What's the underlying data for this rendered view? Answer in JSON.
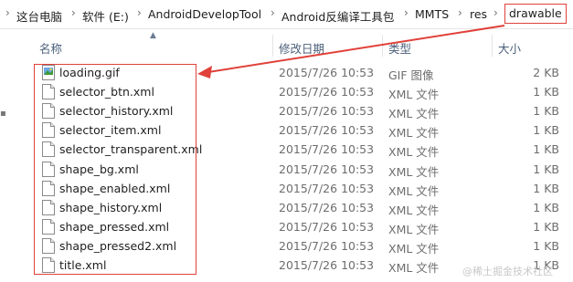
{
  "breadcrumb": {
    "items": [
      "这台电脑",
      "软件 (E:)",
      "AndroidDevelopTool",
      "Android反编译工具包",
      "MMTS",
      "res",
      "drawable"
    ],
    "separator": "›",
    "highlight_color": "#e0413a"
  },
  "columns": {
    "name": "名称",
    "date": "修改日期",
    "type": "类型",
    "size": "大小"
  },
  "files": [
    {
      "name": "loading.gif",
      "date": "2015/7/26 10:53",
      "type": "GIF 图像",
      "size": "2 KB",
      "icon": "gif-image-icon"
    },
    {
      "name": "selector_btn.xml",
      "date": "2015/7/26 10:53",
      "type": "XML 文件",
      "size": "1 KB",
      "icon": "xml-file-icon"
    },
    {
      "name": "selector_history.xml",
      "date": "2015/7/26 10:53",
      "type": "XML 文件",
      "size": "1 KB",
      "icon": "xml-file-icon"
    },
    {
      "name": "selector_item.xml",
      "date": "2015/7/26 10:53",
      "type": "XML 文件",
      "size": "1 KB",
      "icon": "xml-file-icon"
    },
    {
      "name": "selector_transparent.xml",
      "date": "2015/7/26 10:53",
      "type": "XML 文件",
      "size": "1 KB",
      "icon": "xml-file-icon"
    },
    {
      "name": "shape_bg.xml",
      "date": "2015/7/26 10:53",
      "type": "XML 文件",
      "size": "1 KB",
      "icon": "xml-file-icon"
    },
    {
      "name": "shape_enabled.xml",
      "date": "2015/7/26 10:53",
      "type": "XML 文件",
      "size": "1 KB",
      "icon": "xml-file-icon"
    },
    {
      "name": "shape_history.xml",
      "date": "2015/7/26 10:53",
      "type": "XML 文件",
      "size": "1 KB",
      "icon": "xml-file-icon"
    },
    {
      "name": "shape_pressed.xml",
      "date": "2015/7/26 10:53",
      "type": "XML 文件",
      "size": "1 KB",
      "icon": "xml-file-icon"
    },
    {
      "name": "shape_pressed2.xml",
      "date": "2015/7/26 10:53",
      "type": "XML 文件",
      "size": "1 KB",
      "icon": "xml-file-icon"
    },
    {
      "name": "title.xml",
      "date": "2015/7/26 10:53",
      "type": "XML 文件",
      "size": "1 KB",
      "icon": "xml-file-icon"
    }
  ],
  "watermark": "@稀土掘金技术社区",
  "annotation_color": "#e0413a"
}
